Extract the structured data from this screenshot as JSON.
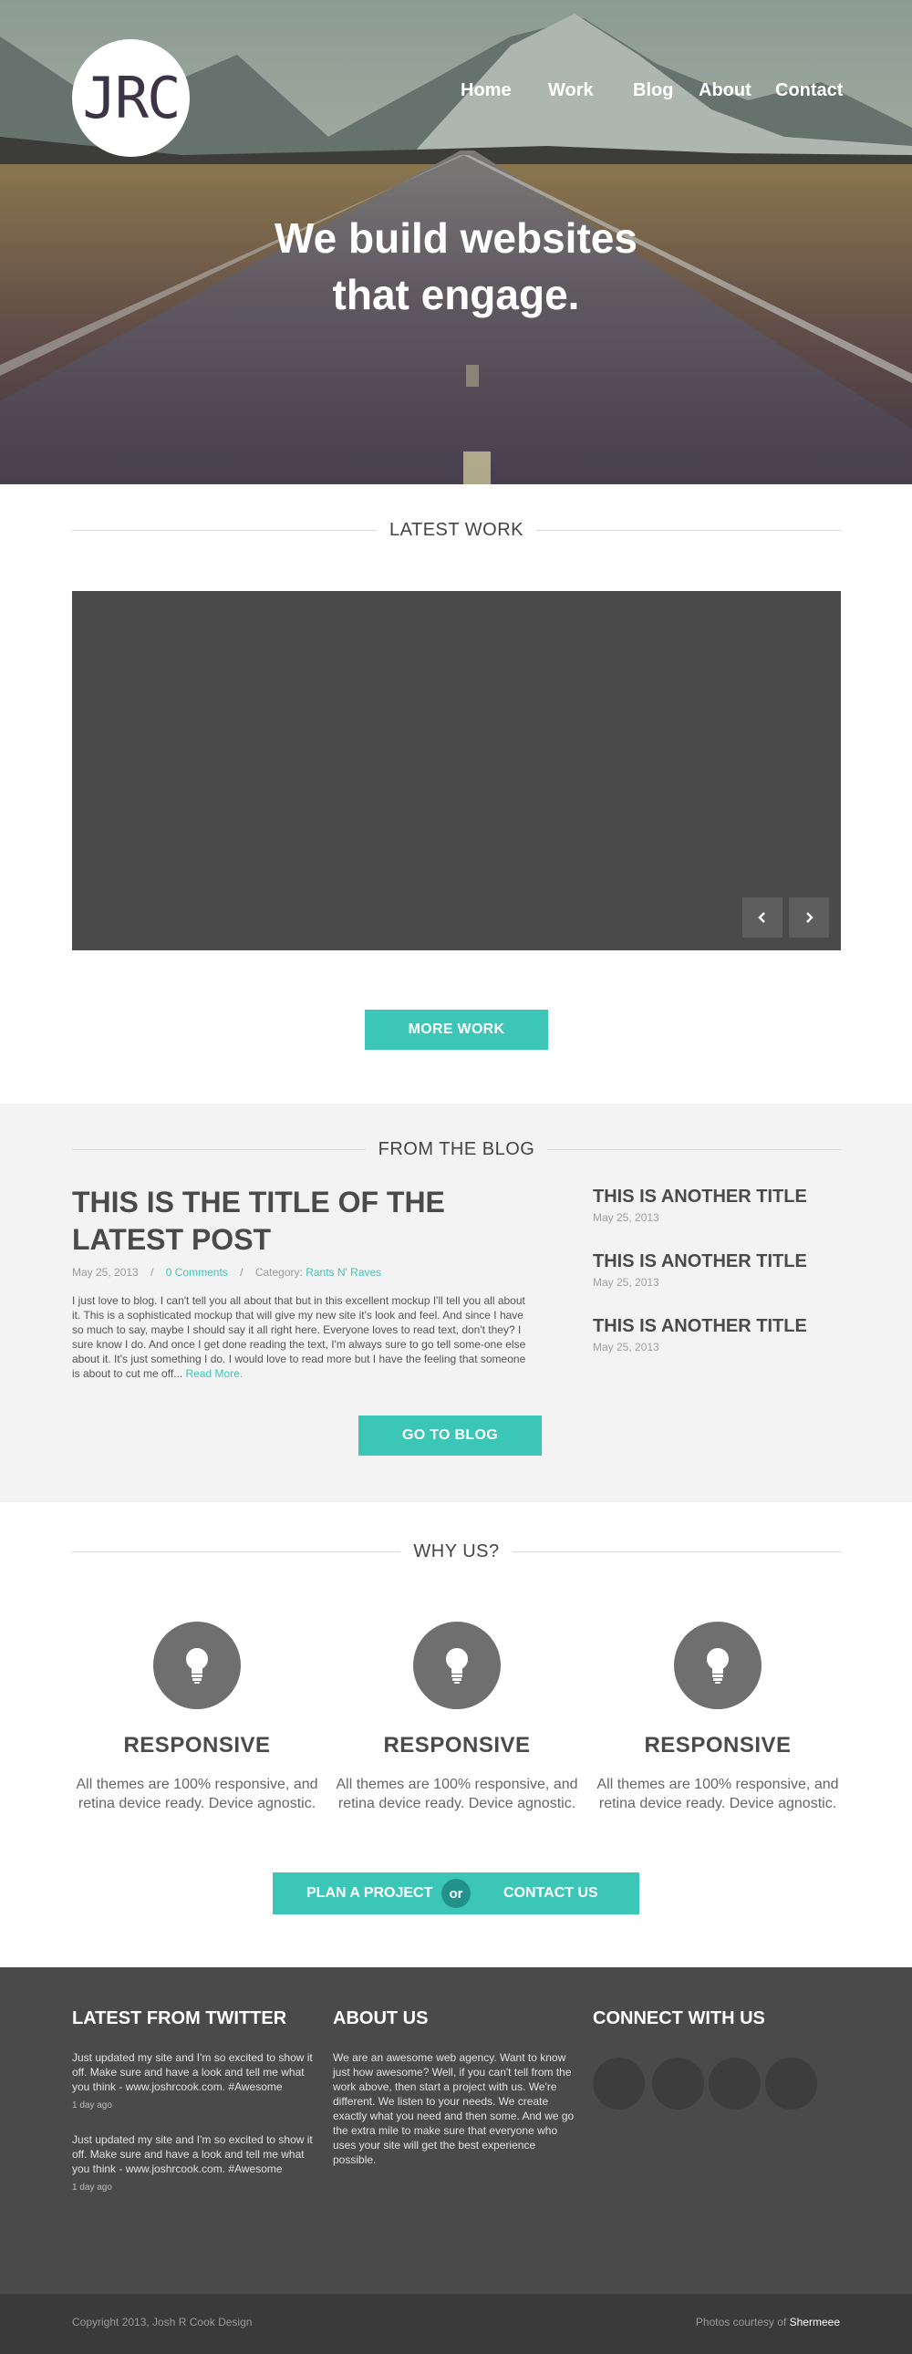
{
  "header": {
    "logo_text": "JRC",
    "nav": [
      {
        "label": "Home"
      },
      {
        "label": "Work"
      },
      {
        "label": "Blog"
      },
      {
        "label": "About"
      },
      {
        "label": "Contact"
      }
    ],
    "headline_line1": "We build websites",
    "headline_line2": "that engage."
  },
  "latest_work": {
    "heading": "LATEST WORK",
    "prev_icon": "chevron-left-icon",
    "next_icon": "chevron-right-icon",
    "button": "MORE WORK"
  },
  "blog": {
    "heading": "FROM THE BLOG",
    "main_post": {
      "title": "THIS IS THE TITLE OF THE LATEST POST",
      "date": "May 25, 2013",
      "sep": "/",
      "comments": "0 Comments",
      "category_label": "Category:",
      "category": "Rants N' Raves",
      "excerpt": "I just love to blog.  I can't tell you all about that but in this excellent mockup I'll tell you all about it.  This is a sophisticated mockup that will give my new site it's look and feel.  And since I have so much to say, maybe I should say it all right here.  Everyone loves to read text, don't they?  I sure know I do.  And once I get done reading the text, I'm always sure to go tell some-one else about it.  It's just something I do.  I would love to read more but I have the feeling that someone is about to cut me off...",
      "read_more": "Read More."
    },
    "side_posts": [
      {
        "title": "THIS IS ANOTHER TITLE",
        "date": "May 25, 2013"
      },
      {
        "title": "THIS IS ANOTHER TITLE",
        "date": "May 25, 2013"
      },
      {
        "title": "THIS IS ANOTHER TITLE",
        "date": "May 25, 2013"
      }
    ],
    "button": "GO TO BLOG"
  },
  "why_us": {
    "heading": "WHY US?",
    "features": [
      {
        "icon": "lightbulb-icon",
        "title": "RESPONSIVE",
        "text": "All themes are 100% responsive, and retina device ready. Device agnostic."
      },
      {
        "icon": "lightbulb-icon",
        "title": "RESPONSIVE",
        "text": "All themes are 100% responsive, and retina device ready. Device agnostic."
      },
      {
        "icon": "lightbulb-icon",
        "title": "RESPONSIVE",
        "text": "All themes are 100% responsive, and retina device ready. Device agnostic."
      }
    ],
    "cta_left": "PLAN A PROJECT",
    "cta_or": "or",
    "cta_right": "CONTACT US"
  },
  "footer": {
    "twitter_heading": "LATEST FROM TWITTER",
    "tweets": [
      {
        "text": "Just updated my site and I'm so excited to show it off.  Make sure and have a look and tell me what you think - www.joshrcook.com. #Awesome",
        "time": "1 day ago"
      },
      {
        "text": "Just updated my site and I'm so excited to show it off.  Make sure and have a look and tell me what you think - www.joshrcook.com. #Awesome",
        "time": "1 day ago"
      }
    ],
    "about_heading": "ABOUT US",
    "about_text": "We are an awesome web agency.  Want to know just how awesome?  Well, if you can't tell from the work above, then start a project with us.  We're different.  We listen to your needs.  We create exactly what you need and then some.  And we go the extra mile to make sure that everyone who uses your site will get the best experience possible.",
    "connect_heading": "CONNECT WITH US",
    "copyright": "Copyright 2013, Josh R Cook Design",
    "photos_label": "Photos courtesy of",
    "photos_credit": "Shermeee"
  },
  "colors": {
    "accent": "#3cc6b7",
    "dark": "#4a4a4a",
    "light_bg": "#f3f3f3"
  }
}
